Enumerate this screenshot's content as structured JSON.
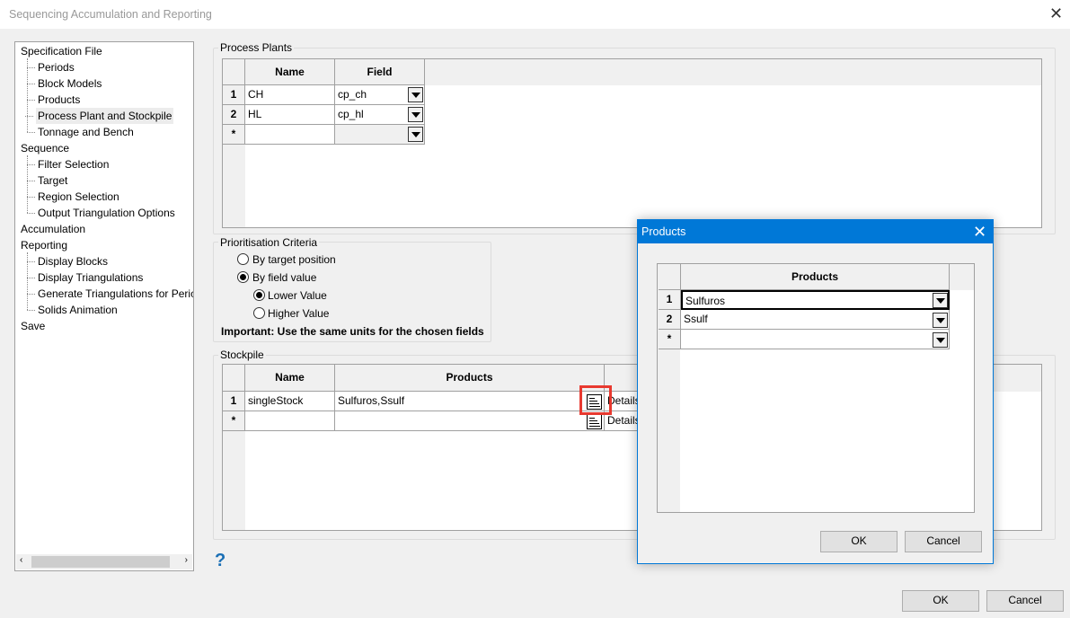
{
  "window": {
    "title": "Sequencing Accumulation and Reporting",
    "ok": "OK",
    "cancel": "Cancel",
    "help": "?"
  },
  "tree": [
    {
      "label": "Specification File",
      "level": 0
    },
    {
      "label": "Periods",
      "level": 1
    },
    {
      "label": "Block Models",
      "level": 1
    },
    {
      "label": "Products",
      "level": 1
    },
    {
      "label": "Process Plant and Stockpile",
      "level": 1,
      "selected": true
    },
    {
      "label": "Tonnage and Bench",
      "level": 1
    },
    {
      "label": "Sequence",
      "level": 0
    },
    {
      "label": "Filter Selection",
      "level": 1
    },
    {
      "label": "Target",
      "level": 1
    },
    {
      "label": "Region Selection",
      "level": 1
    },
    {
      "label": "Output Triangulation Options",
      "level": 1
    },
    {
      "label": "Accumulation",
      "level": 0
    },
    {
      "label": "Reporting",
      "level": 0
    },
    {
      "label": "Display Blocks",
      "level": 1
    },
    {
      "label": "Display Triangulations",
      "level": 1
    },
    {
      "label": "Generate Triangulations for Peric",
      "level": 1
    },
    {
      "label": "Solids Animation",
      "level": 1
    },
    {
      "label": "Save",
      "level": 0
    }
  ],
  "process_plants": {
    "label": "Process Plants",
    "headers": [
      "Name",
      "Field"
    ],
    "rows": [
      {
        "num": "1",
        "name": "CH",
        "field": "cp_ch"
      },
      {
        "num": "2",
        "name": "HL",
        "field": "cp_hl"
      },
      {
        "num": "*",
        "name": "",
        "field": ""
      }
    ]
  },
  "prioritisation": {
    "label": "Prioritisation Criteria",
    "by_target": "By target position",
    "by_field": "By field value",
    "lower": "Lower Value",
    "higher": "Higher Value",
    "selected": "By field value",
    "order": "Lower Value",
    "note": "Important: Use the same units for the chosen fields"
  },
  "stockpile": {
    "label": "Stockpile",
    "headers": [
      "Name",
      "Products"
    ],
    "details": "Details",
    "rows": [
      {
        "num": "1",
        "name": "singleStock",
        "products": "Sulfuros,Ssulf"
      },
      {
        "num": "*",
        "name": "",
        "products": ""
      }
    ]
  },
  "products_dialog": {
    "title": "Products",
    "header": "Products",
    "rows": [
      {
        "num": "1",
        "value": "Sulfuros"
      },
      {
        "num": "2",
        "value": "Ssulf"
      },
      {
        "num": "*",
        "value": ""
      }
    ],
    "ok": "OK",
    "cancel": "Cancel",
    "accent": "#0078d7"
  },
  "highlight_color": "#e8392f"
}
